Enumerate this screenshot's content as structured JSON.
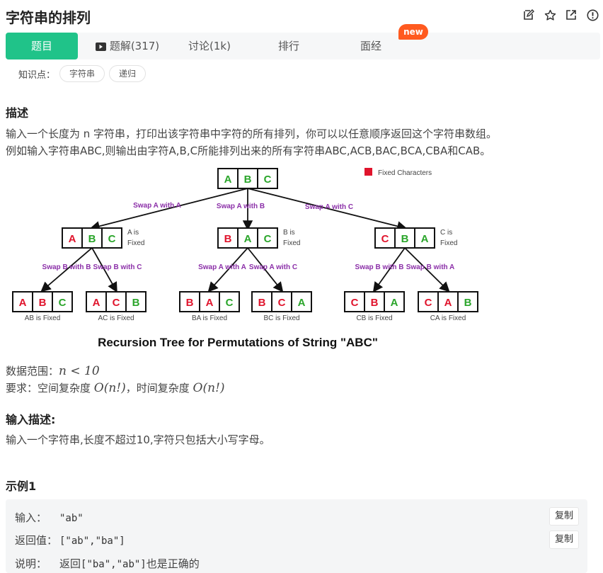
{
  "header": {
    "title": "字符串的排列",
    "icons": [
      "edit-icon",
      "star-icon",
      "share-icon",
      "info-icon"
    ]
  },
  "tabs": [
    {
      "label": "题目",
      "active": true
    },
    {
      "label": "题解(317)",
      "icon": "video-icon"
    },
    {
      "label": "讨论(1k)"
    },
    {
      "label": "排行"
    },
    {
      "label": "面经",
      "badge": "new"
    }
  ],
  "knowledge": {
    "label": "知识点：",
    "tags": [
      "字符串",
      "递归"
    ]
  },
  "description": {
    "heading": "描述",
    "line1": "输入一个长度为 n 字符串，打印出该字符串中字符的所有排列，你可以以任意顺序返回这个字符串数组。",
    "line2": "例如输入字符串ABC,则输出由字符A,B,C所能排列出来的所有字符串ABC,ACB,BAC,BCA,CBA和CAB。"
  },
  "diagram": {
    "legend": "Fixed Characters",
    "caption": "Recursion Tree for Permutations of String \"ABC\"",
    "root": [
      "A",
      "B",
      "C"
    ],
    "level1": [
      {
        "edge": "Swap A with A",
        "chars": [
          "A",
          "B",
          "C"
        ],
        "note1": "A is",
        "note2": "Fixed"
      },
      {
        "edge": "Swap A with B",
        "chars": [
          "B",
          "A",
          "C"
        ],
        "note1": "B is",
        "note2": "Fixed"
      },
      {
        "edge": "Swap A with C",
        "chars": [
          "C",
          "B",
          "A"
        ],
        "note1": "C is",
        "note2": "Fixed"
      }
    ],
    "level2": [
      {
        "edge": "Swap B with B",
        "chars": [
          "A",
          "B",
          "C"
        ],
        "note": "AB is Fixed"
      },
      {
        "edge": "Swap B with C",
        "chars": [
          "A",
          "C",
          "B"
        ],
        "note": "AC is Fixed"
      },
      {
        "edge": "Swap A with A",
        "chars": [
          "B",
          "A",
          "C"
        ],
        "note": "BA is Fixed"
      },
      {
        "edge": "Swap A with C",
        "chars": [
          "B",
          "C",
          "A"
        ],
        "note": "BC is Fixed"
      },
      {
        "edge": "Swap B with B",
        "chars": [
          "C",
          "B",
          "A"
        ],
        "note": "CB is Fixed"
      },
      {
        "edge": "Swap B with A",
        "chars": [
          "C",
          "A",
          "B"
        ],
        "note": "CA is Fixed"
      }
    ],
    "colors": {
      "fixed": "#e0142c",
      "free": "#2aa52a",
      "edge": "#8b2fa8"
    }
  },
  "constraints": {
    "range_label": "数据范围：",
    "range_math": "n < 10",
    "req_label": "要求：空间复杂度 ",
    "space_math": "O(n!)",
    "req_mid": "，时间复杂度 ",
    "time_math": "O(n!)"
  },
  "input_desc": {
    "heading": "输入描述:",
    "text": "输入一个字符串,长度不超过10,字符只包括大小写字母。"
  },
  "example": {
    "heading": "示例1",
    "input_label": "输入：",
    "input_value": "\"ab\"",
    "output_label": "返回值：",
    "output_value": "[\"ab\",\"ba\"]",
    "explain_label": "说明：",
    "explain_prefix": "返回",
    "explain_code": "[\"ba\",\"ab\"]",
    "explain_suffix": "也是正确的",
    "copy_label": "复制"
  },
  "accent": "#20c389"
}
